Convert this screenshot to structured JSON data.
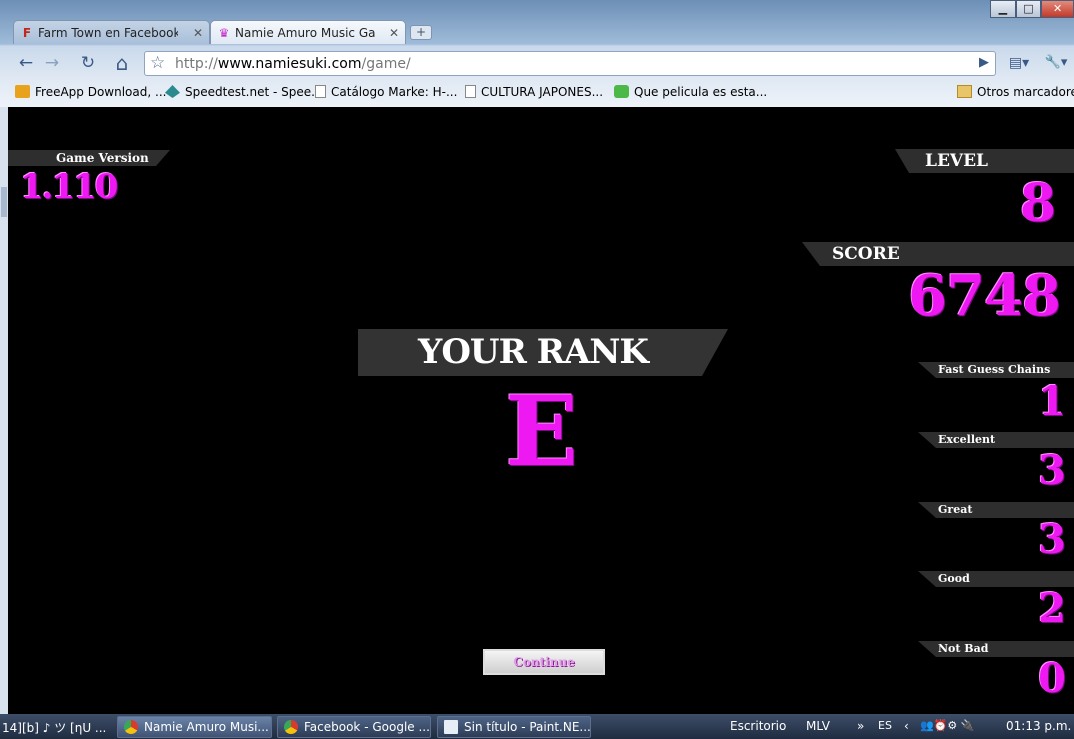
{
  "window": {
    "minimize": "▁",
    "maximize": "□",
    "close": "✕"
  },
  "tabs": [
    {
      "label": "Farm Town en Facebook ...",
      "icon": "F",
      "close": "✕"
    },
    {
      "label": "Namie Amuro Music Ga...",
      "icon": "♛",
      "close": "✕"
    }
  ],
  "new_tab": "+",
  "toolbar": {
    "back": "←",
    "forward": "→",
    "reload": "↻",
    "home": "⌂",
    "page_menu": "▤▾",
    "tools_menu": "🔧▾"
  },
  "address": {
    "protocol": "http://",
    "host": "www.namiesuki.com",
    "path": "/game/",
    "go": "▶"
  },
  "bookmarks": [
    {
      "label": "FreeApp Download, ...",
      "icon": "freeapp-icon"
    },
    {
      "label": "Speedtest.net - Spee...",
      "icon": "speedtest-icon"
    },
    {
      "label": "Catálogo Marke: H-...",
      "icon": "page-icon"
    },
    {
      "label": "CULTURA JAPONES...",
      "icon": "page-icon"
    },
    {
      "label": "Que pelicula es esta...",
      "icon": "asterisk-icon"
    },
    {
      "label": "Otros marcadores",
      "icon": "folder-icon"
    }
  ],
  "game": {
    "version_label": "Game Version",
    "version": "1.110",
    "level_label": "LEVEL",
    "level": "8",
    "score_label": "SCORE",
    "score": "6748",
    "rank_label": "YOUR RANK",
    "rank": "E",
    "stats": [
      {
        "label": "Fast Guess Chains",
        "value": "1"
      },
      {
        "label": "Excellent",
        "value": "3"
      },
      {
        "label": "Great",
        "value": "3"
      },
      {
        "label": "Good",
        "value": "2"
      },
      {
        "label": "Not Bad",
        "value": "0"
      }
    ],
    "continue": "Continue",
    "accent": "#ee18f2"
  },
  "taskbar": {
    "left_text": "14][b] ♪ ツ [ηU ...",
    "tasks": [
      {
        "label": "Namie Amuro Musi...",
        "icon": "chrome-icon"
      },
      {
        "label": "Facebook - Google ...",
        "icon": "chrome-icon"
      },
      {
        "label": "Sin título - Paint.NE...",
        "icon": "paint-icon"
      }
    ],
    "desktop": "Escritorio",
    "mlv": "MLV",
    "chevron": "»",
    "lang": "ES",
    "clock": "01:13 p.m."
  }
}
